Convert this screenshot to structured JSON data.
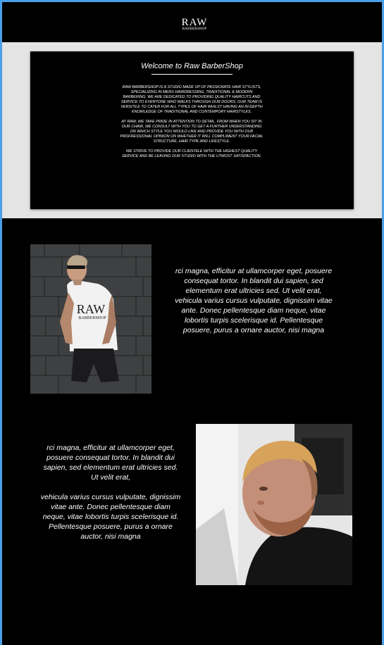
{
  "header": {
    "logo_main": "RAW",
    "logo_sub": "BARBERSHOP"
  },
  "welcome": {
    "title": "Welcome to Raw BarberShop",
    "paragraphs": [
      "RAW BARBERSHOP IS A STUDIO MADE UP OF PASSIONATE HAIR STYLISTS, SPECIALIZING IN MENS HAIRDRESSING, TRADITIONAL & MODERN BARBERING. WE ARE DEDICATED TO PROVIDING QUALITY HAIRCUTS AND SERVICE TO EVERYONE WHO WALKS THROUGH OUR DOORS. OUR TEAM IS VERSITILE TO CATER FOR ALL TYPES OF HAIR WHILST HAVING AN IN-DEPTH KNOWLEDGE OF TRADITIONAL AND CONTEMPORY HAIRSTYLES.",
      "AT RAW, WE TAKE PRIDE IN ATTENTION TO DETAIL. FROM WHEN YOU SIT IN OUR CHAIR, WE CONSULT WITH YOU TO GET A FURTHER UNDERSTANDING ON WHICH STYLE YOU WOULD LIKE AND PROVIDE YOU WITH OUR PROFRESSIONAL OPINION ON WHETHER IT WILL COMPLIMENT YOUR FACIAL STRUCTURE, HAIR TYPE AND LIFESTYLE.",
      "WE STRIVE TO PROVIDE OUR CLIENTELE WITH THE HIGHEST QUALITY SERVICE AND BE LEAVING OUR STUDIO WITH THE UTMOST SATISFACTION."
    ]
  },
  "feature1": {
    "photo_shirt_text": "RAW",
    "photo_shirt_sub": "BARBERSHOP",
    "text": "rci magna, efficitur at ullamcorper eget, posuere consequat tortor. In blandit dui sapien, sed elementum erat ultricies sed. Ut velit erat, vehicula varius cursus vulputate, dignissim vitae ante. Donec pellentesque diam neque, vitae lobortis turpis scelerisque id. Pellentesque posuere, purus a ornare auctor, nisi magna"
  },
  "feature2": {
    "text_p1": "rci magna, efficitur at ullamcorper eget, posuere consequat tortor. In blandit dui sapien, sed elementum erat ultricies sed. Ut velit erat,",
    "text_p2": "vehicula varius cursus vulputate, dignissim vitae ante. Donec pellentesque diam neque, vitae lobortis turpis scelerisque id. Pellentesque posuere, purus a ornare auctor, nisi magna"
  },
  "colors": {
    "frame_border": "#4a9fe8",
    "background": "#000000",
    "band": "#e4e4e4"
  }
}
